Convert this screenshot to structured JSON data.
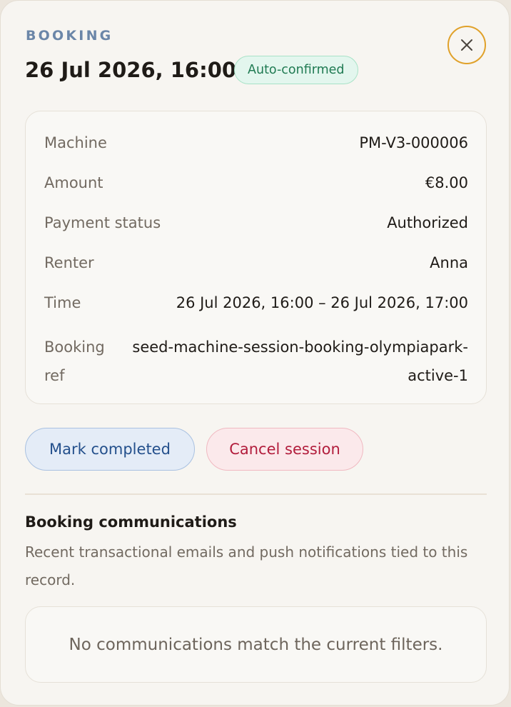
{
  "header": {
    "eyebrow": "BOOKING",
    "title": "26 Jul 2026, 16:00",
    "status_badge": "Auto-confirmed",
    "close_icon": "close-icon"
  },
  "details": [
    {
      "label": "Machine",
      "value": "PM-V3-000006"
    },
    {
      "label": "Amount",
      "value": "€8.00"
    },
    {
      "label": "Payment status",
      "value": "Authorized"
    },
    {
      "label": "Renter",
      "value": "Anna"
    },
    {
      "label": "Time",
      "value": "26 Jul 2026, 16:00 – 26 Jul 2026, 17:00"
    }
  ],
  "booking_ref": {
    "label": "Booking ref",
    "value": "seed-machine-session-booking-olympiapark-active-1"
  },
  "actions": {
    "mark_completed": "Mark completed",
    "cancel_session": "Cancel session"
  },
  "communications": {
    "title": "Booking communications",
    "description": "Recent transactional emails and push notifications tied to this record.",
    "empty_message": "No communications match the current filters."
  },
  "colors": {
    "accent_eyebrow": "#6b86a8",
    "close_ring": "#e0a12a",
    "badge_green": "#1f7a52",
    "complete_blue": "#24508c",
    "cancel_red": "#b21d3c"
  }
}
